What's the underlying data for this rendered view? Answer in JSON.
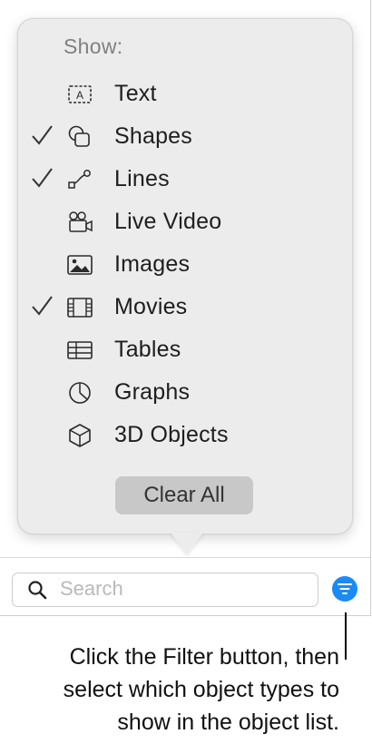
{
  "popover": {
    "title": "Show:",
    "items": [
      {
        "label": "Text",
        "icon": "text-box-icon",
        "checked": false
      },
      {
        "label": "Shapes",
        "icon": "shapes-icon",
        "checked": true
      },
      {
        "label": "Lines",
        "icon": "lines-icon",
        "checked": true
      },
      {
        "label": "Live Video",
        "icon": "live-video-icon",
        "checked": false
      },
      {
        "label": "Images",
        "icon": "image-icon",
        "checked": false
      },
      {
        "label": "Movies",
        "icon": "film-icon",
        "checked": true
      },
      {
        "label": "Tables",
        "icon": "table-icon",
        "checked": false
      },
      {
        "label": "Graphs",
        "icon": "pie-chart-icon",
        "checked": false
      },
      {
        "label": "3D Objects",
        "icon": "cube-icon",
        "checked": false
      }
    ],
    "clear_all_label": "Clear All"
  },
  "search": {
    "placeholder": "Search",
    "value": ""
  },
  "filter_button": {
    "icon": "filter-icon",
    "color": "#1a8bf5"
  },
  "caption": {
    "line1": "Click the Filter button, then",
    "line2": "select which object types to",
    "line3": "show in the object list."
  }
}
